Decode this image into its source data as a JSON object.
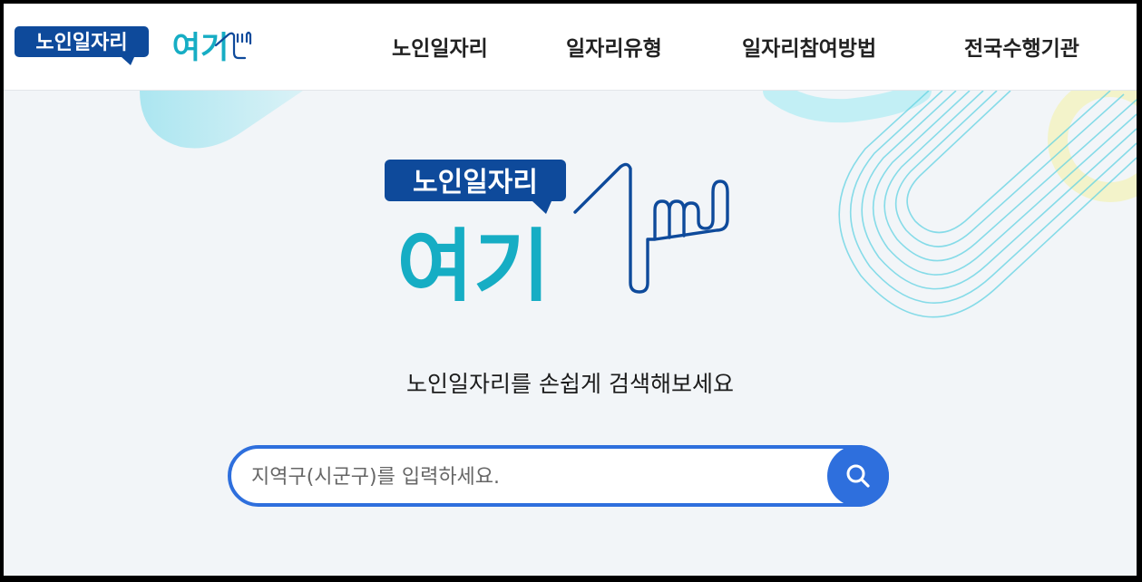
{
  "header": {
    "logo": {
      "text_main": "노인일자리",
      "text_accent": "여기"
    },
    "nav": [
      {
        "label": "노인일자리"
      },
      {
        "label": "일자리유형"
      },
      {
        "label": "일자리참여방법"
      },
      {
        "label": "전국수행기관"
      }
    ]
  },
  "hero": {
    "logo": {
      "text_main": "노인일자리",
      "text_accent": "여기"
    },
    "tagline": "노인일자리를 손쉽게 검색해보세요"
  },
  "search": {
    "placeholder": "지역구(시군구)를 입력하세요.",
    "value": "",
    "button_icon": "search-icon"
  },
  "colors": {
    "brand_navy": "#0e4a9b",
    "brand_teal": "#16adc4",
    "accent_blue": "#2e6fdd",
    "background": "#f2f5f8"
  }
}
